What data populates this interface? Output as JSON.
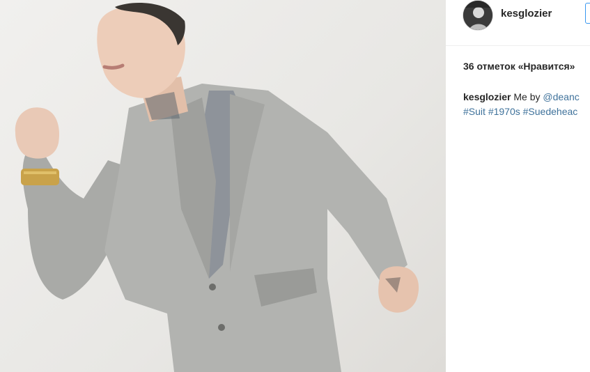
{
  "post": {
    "username": "kesglozier",
    "likes_text": "36 отметок «Нравится»",
    "caption": {
      "user": "kesglozier",
      "text": "Me by",
      "mention": "@deanc",
      "hashtags": [
        "#Suit",
        "#1970s",
        "#Suedeheac"
      ]
    }
  },
  "colors": {
    "link": "#3f729b",
    "follow_border": "#3897f0",
    "divider": "#efefef",
    "text": "#262626"
  },
  "icons": {
    "avatar": "profile-photo"
  }
}
